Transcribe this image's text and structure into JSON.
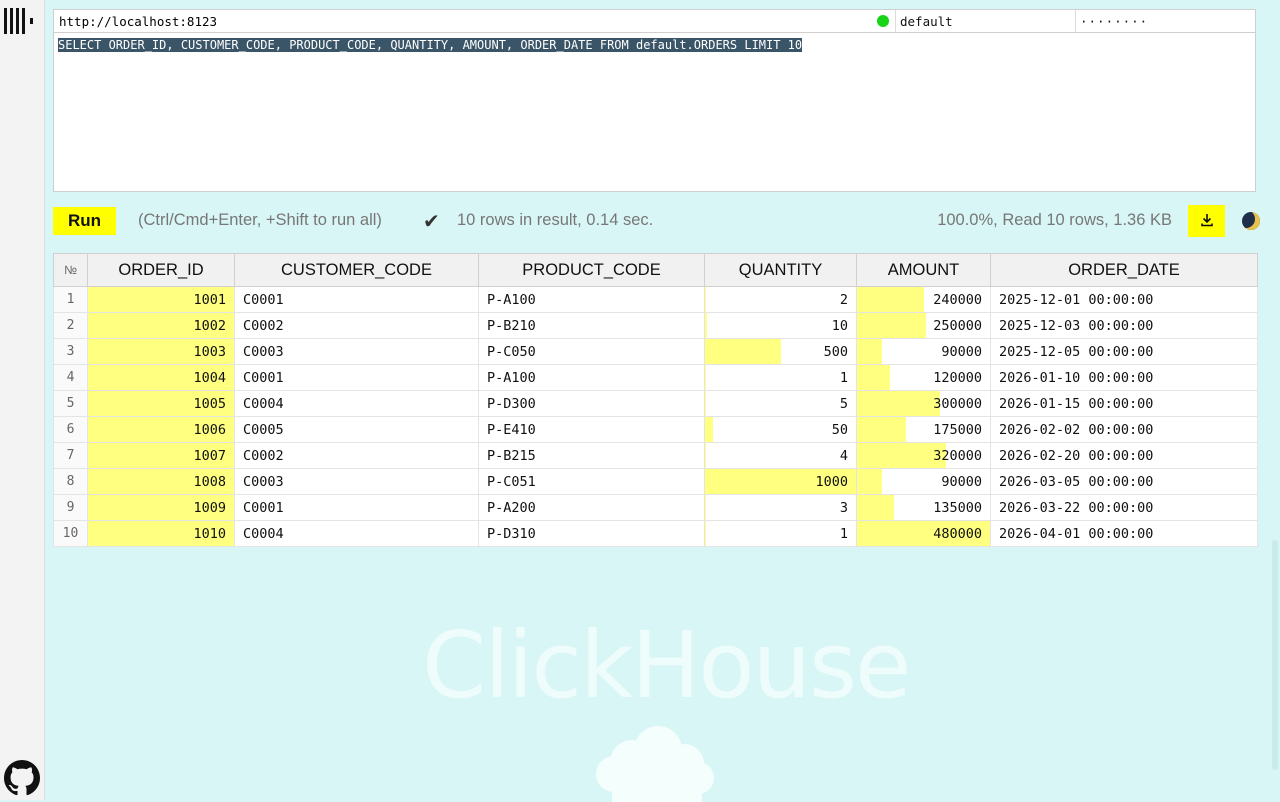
{
  "connection": {
    "url": "http://localhost:8123",
    "user": "default",
    "password_mask": "········",
    "status_color": "#18d418"
  },
  "editor": {
    "query": "SELECT ORDER_ID, CUSTOMER_CODE, PRODUCT_CODE, QUANTITY, AMOUNT, ORDER_DATE FROM default.ORDERS LIMIT 10"
  },
  "toolbar": {
    "run_label": "Run",
    "hint": "(Ctrl/Cmd+Enter, +Shift to run all)",
    "check_glyph": "✔",
    "status": "10 rows in result, 0.14 sec.",
    "stats": "100.0%, Read 10 rows, 1.36 KB"
  },
  "table": {
    "row_number_header": "№",
    "columns": [
      "ORDER_ID",
      "CUSTOMER_CODE",
      "PRODUCT_CODE",
      "QUANTITY",
      "AMOUNT",
      "ORDER_DATE"
    ],
    "rows": [
      {
        "n": "1",
        "order_id": "1001",
        "customer": "C0001",
        "product": "P-A100",
        "quantity": "2",
        "amount": "240000",
        "date": "2025-12-01 00:00:00",
        "order_bar": 1,
        "qty_bar": 0.002,
        "amt_bar": 0.5
      },
      {
        "n": "2",
        "order_id": "1002",
        "customer": "C0002",
        "product": "P-B210",
        "quantity": "10",
        "amount": "250000",
        "date": "2025-12-03 00:00:00",
        "order_bar": 1,
        "qty_bar": 0.01,
        "amt_bar": 0.521
      },
      {
        "n": "3",
        "order_id": "1003",
        "customer": "C0003",
        "product": "P-C050",
        "quantity": "500",
        "amount": "90000",
        "date": "2025-12-05 00:00:00",
        "order_bar": 1,
        "qty_bar": 0.5,
        "amt_bar": 0.1875
      },
      {
        "n": "4",
        "order_id": "1004",
        "customer": "C0001",
        "product": "P-A100",
        "quantity": "1",
        "amount": "120000",
        "date": "2026-01-10 00:00:00",
        "order_bar": 1,
        "qty_bar": 0.001,
        "amt_bar": 0.25
      },
      {
        "n": "5",
        "order_id": "1005",
        "customer": "C0004",
        "product": "P-D300",
        "quantity": "5",
        "amount": "300000",
        "date": "2026-01-15 00:00:00",
        "order_bar": 1,
        "qty_bar": 0.005,
        "amt_bar": 0.625
      },
      {
        "n": "6",
        "order_id": "1006",
        "customer": "C0005",
        "product": "P-E410",
        "quantity": "50",
        "amount": "175000",
        "date": "2026-02-02 00:00:00",
        "order_bar": 1,
        "qty_bar": 0.05,
        "amt_bar": 0.365
      },
      {
        "n": "7",
        "order_id": "1007",
        "customer": "C0002",
        "product": "P-B215",
        "quantity": "4",
        "amount": "320000",
        "date": "2026-02-20 00:00:00",
        "order_bar": 1,
        "qty_bar": 0.004,
        "amt_bar": 0.667
      },
      {
        "n": "8",
        "order_id": "1008",
        "customer": "C0003",
        "product": "P-C051",
        "quantity": "1000",
        "amount": "90000",
        "date": "2026-03-05 00:00:00",
        "order_bar": 1,
        "qty_bar": 1,
        "amt_bar": 0.1875
      },
      {
        "n": "9",
        "order_id": "1009",
        "customer": "C0001",
        "product": "P-A200",
        "quantity": "3",
        "amount": "135000",
        "date": "2026-03-22 00:00:00",
        "order_bar": 1,
        "qty_bar": 0.003,
        "amt_bar": 0.281
      },
      {
        "n": "10",
        "order_id": "1010",
        "customer": "C0004",
        "product": "P-D310",
        "quantity": "1",
        "amount": "480000",
        "date": "2026-04-01 00:00:00",
        "order_bar": 1,
        "qty_bar": 0.001,
        "amt_bar": 1
      }
    ]
  },
  "watermark": "ClickHouse",
  "icons": {
    "logo": "clickhouse-logo-icon",
    "github": "github-icon",
    "download": "download-icon",
    "theme": "theme-toggle-icon",
    "cloud": "cloud-icon"
  },
  "colors": {
    "background": "#d8f6f5",
    "accent": "#ffff00",
    "bar": "#ffff80",
    "selection": "#3a5568"
  }
}
